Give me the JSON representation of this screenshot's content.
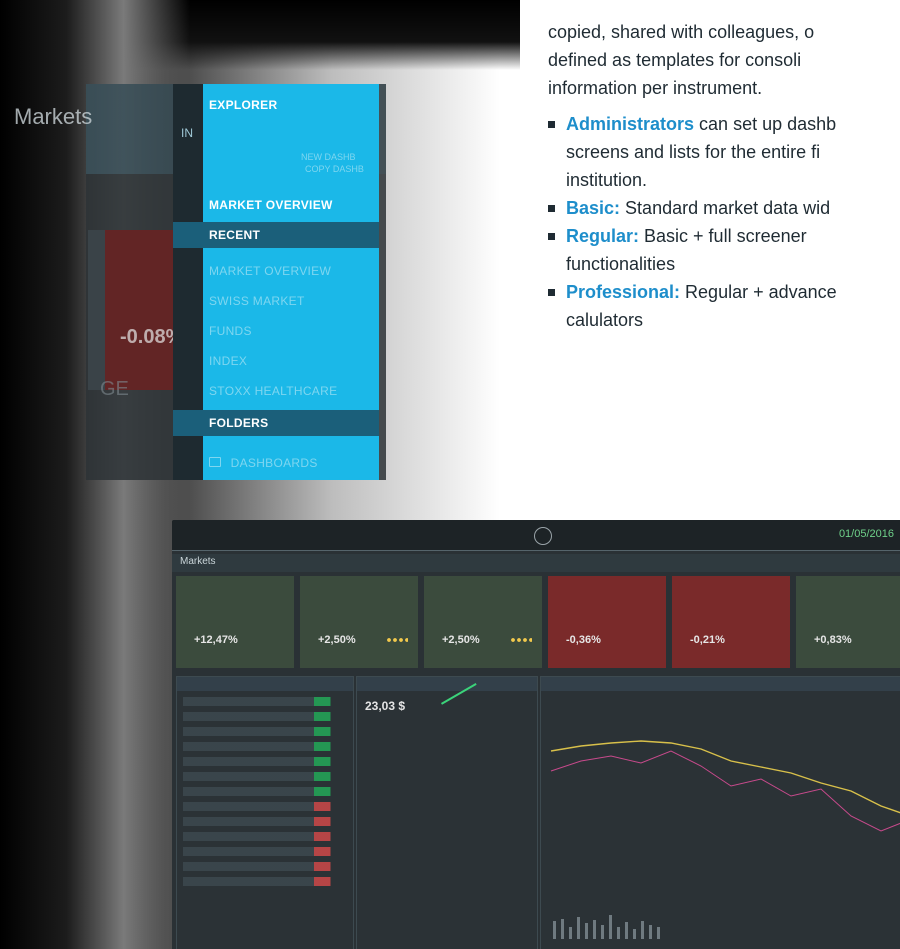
{
  "menu": {
    "explorer": "EXPLORER",
    "small1": "NEW DASHB",
    "small2": "COPY DASHB",
    "market_overview_header": "MARKET OVERVIEW",
    "recent": "RECENT",
    "items": [
      "MARKET OVERVIEW",
      "SWISS MARKET",
      "FUNDS",
      "INDEX",
      "STOXX HEALTHCARE"
    ],
    "folders": "FOLDERS",
    "dashboards": "DASHBOARDS",
    "left_strip": "IN"
  },
  "background_app": {
    "title": "Markets",
    "pct": "-0.08%",
    "side_fragment": "GE"
  },
  "text": {
    "line1": "copied, shared with colleagues, o",
    "line2": "defined as templates for consoli",
    "line3": "information per instrument.",
    "bullets": [
      {
        "accent": "Administrators",
        "rest": " can set up dashb"
      },
      {
        "accent": "",
        "rest": "screens and lists for the entire fi"
      },
      {
        "accent": "",
        "rest": "institution."
      }
    ],
    "tiers": [
      {
        "label": "Basic:",
        "desc": " Standard market data wid"
      },
      {
        "label": "Regular:",
        "desc": " Basic + full screener"
      },
      {
        "label": "",
        "desc": "functionalities"
      },
      {
        "label": "Professional:",
        "desc": " Regular + advance"
      },
      {
        "label": "",
        "desc": "calulators"
      }
    ]
  },
  "screen": {
    "title": "Markets",
    "clock": "01/05/2016",
    "cards": [
      "+12,47%",
      "+2,50%",
      "+2,50%",
      "-0,36%",
      "-0,21%",
      "+0,83%"
    ],
    "value": "23,03 $"
  }
}
